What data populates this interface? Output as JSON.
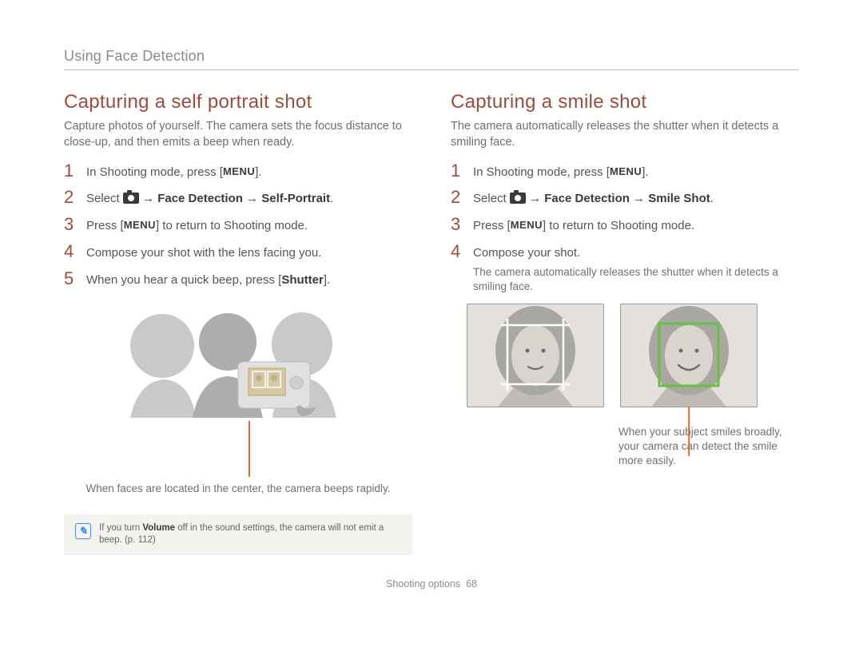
{
  "header": {
    "section_title": "Using Face Detection"
  },
  "left": {
    "heading": "Capturing a self portrait shot",
    "intro": "Capture photos of yourself. The camera sets the focus distance to close-up, and then emits a beep when ready.",
    "steps": {
      "s1_a": "In Shooting mode, press [",
      "s1_b": "MENU",
      "s1_c": "].",
      "s2_a": "Select ",
      "s2_b": " → Face Detection → Self-Portrait",
      "s2_c": ".",
      "s3_a": "Press [",
      "s3_b": "MENU",
      "s3_c": "] to return to Shooting mode.",
      "s4": "Compose your shot with the lens facing you.",
      "s5_a": "When you hear a quick beep, press [",
      "s5_b": "Shutter",
      "s5_c": "]."
    },
    "illus_caption": "When faces are located in the center, the camera beeps rapidly.",
    "note_a": "If you turn ",
    "note_b": "Volume",
    "note_c": " off in the sound settings, the camera will not emit a beep. (p. 112)"
  },
  "right": {
    "heading": "Capturing a smile shot",
    "intro": "The camera automatically releases the shutter when it detects a smiling face.",
    "steps": {
      "s1_a": "In Shooting mode, press [",
      "s1_b": "MENU",
      "s1_c": "].",
      "s2_a": "Select ",
      "s2_b": " → Face Detection → Smile Shot",
      "s2_c": ".",
      "s3_a": "Press [",
      "s3_b": "MENU",
      "s3_c": "] to return to Shooting mode.",
      "s4": "Compose your shot.",
      "s4_sub": "The camera automatically releases the shutter when it detects a smiling face."
    },
    "smile_caption": "When your subject smiles broadly, your camera can detect the smile more easily."
  },
  "footer": {
    "section": "Shooting options",
    "page": "68"
  }
}
